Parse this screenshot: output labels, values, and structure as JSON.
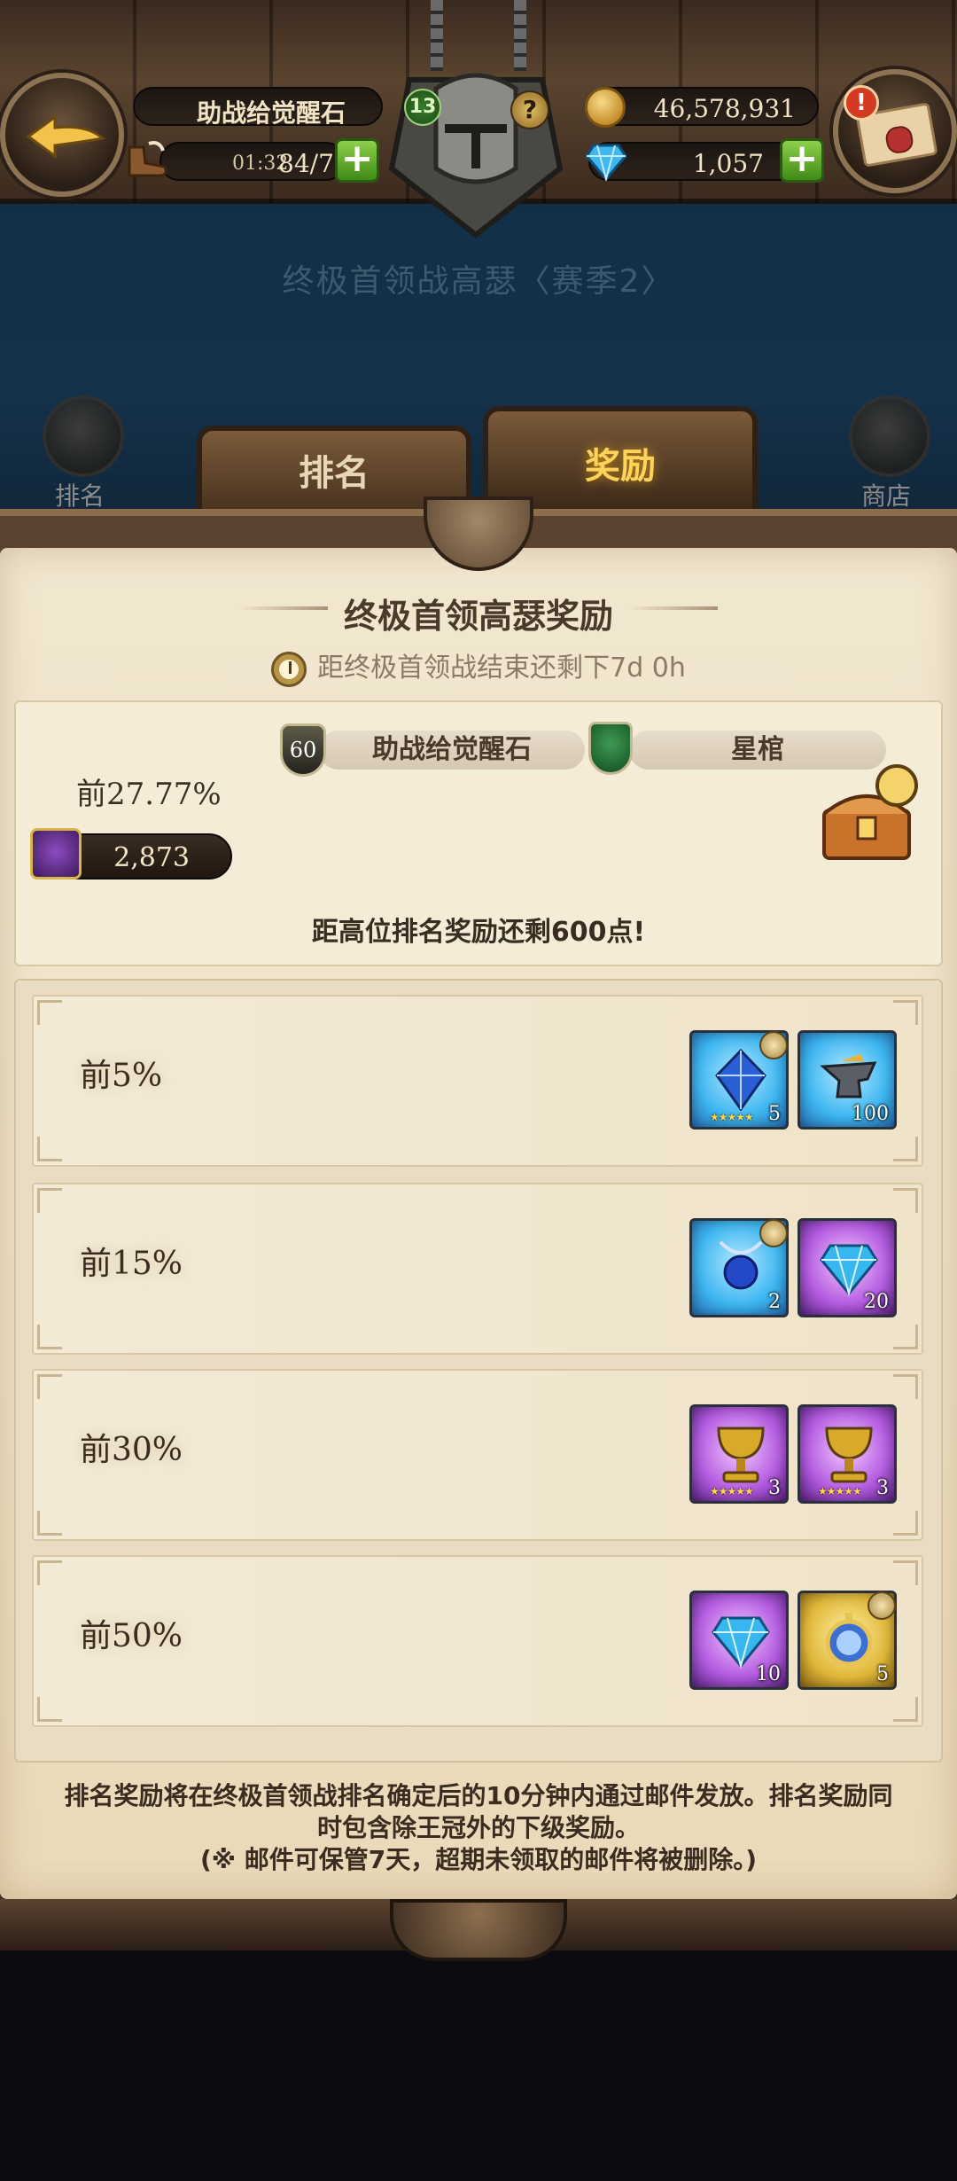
{
  "header": {
    "hero_name": "助战给觉醒石",
    "stamina_timer": "01:32",
    "stamina_value": "84/79",
    "gold": "46,578,931",
    "gems": "1,057",
    "level": "13",
    "alert_mark": "!"
  },
  "page_title": "终极首领战高瑟〈赛季2〉",
  "side_nav": {
    "left_label": "排名",
    "right_label": "商店"
  },
  "tabs": {
    "ranking": "排名",
    "rewards": "奖励"
  },
  "rewards_section": {
    "title": "终极首领高瑟奖励",
    "timer": "距终极首领战结束还剩下7d 0h",
    "hero_level": "60",
    "hero_name": "助战给觉醒石",
    "weapon_name": "星棺",
    "rank_percent": "前27.77%",
    "score": "2,873",
    "remaining_text": "距高位排名奖励还剩600点!"
  },
  "tiers": [
    {
      "label": "前5%",
      "items": [
        {
          "qty": "5",
          "stars": "★★★★★",
          "rarity": "blue",
          "icon": "blue-crystal-icon"
        },
        {
          "qty": "100",
          "stars": "",
          "rarity": "blue",
          "icon": "anvil-icon"
        }
      ]
    },
    {
      "label": "前15%",
      "items": [
        {
          "qty": "2",
          "stars": "",
          "rarity": "blue",
          "icon": "sapphire-necklace-icon"
        },
        {
          "qty": "20",
          "stars": "",
          "rarity": "purple",
          "icon": "diamond-icon"
        }
      ]
    },
    {
      "label": "前30%",
      "items": [
        {
          "qty": "3",
          "stars": "★★★★★",
          "rarity": "purple",
          "icon": "gold-goblet-icon"
        },
        {
          "qty": "3",
          "stars": "★★★★★",
          "rarity": "purple",
          "icon": "gold-goblet-icon"
        }
      ]
    },
    {
      "label": "前50%",
      "items": [
        {
          "qty": "10",
          "stars": "",
          "rarity": "purple",
          "icon": "diamond-icon"
        },
        {
          "qty": "5",
          "stars": "",
          "rarity": "gold",
          "icon": "pocket-watch-icon"
        }
      ]
    }
  ],
  "footer_note": {
    "line1": "排名奖励将在终极首领战排名确定后的10分钟内通过邮件发放。排名奖励同时包含除王冠外的下级奖励。",
    "line2": "(※ 邮件可保管7天，超期未领取的邮件将被删除。)"
  }
}
